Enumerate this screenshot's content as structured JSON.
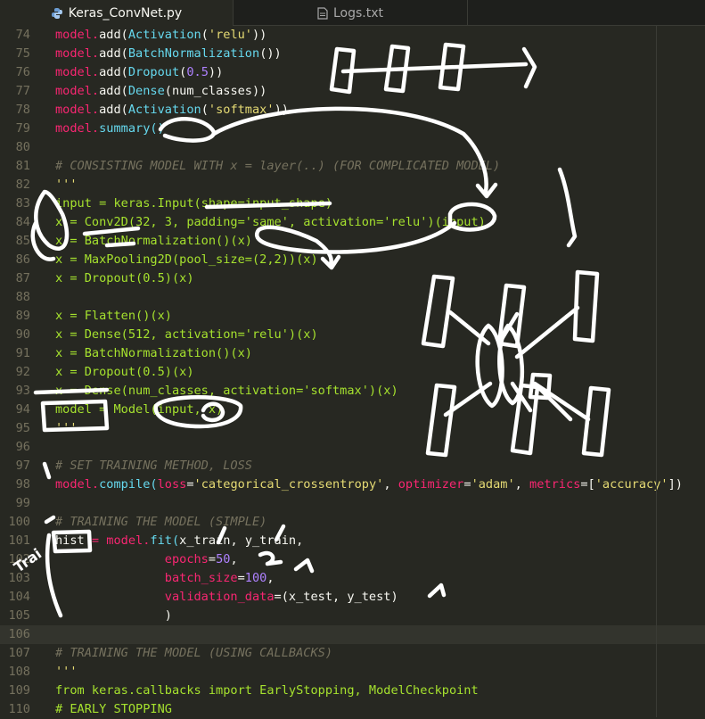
{
  "tabs": [
    {
      "label": "Keras_ConvNet.py",
      "active": true,
      "icon": "python-icon"
    },
    {
      "label": "Logs.txt",
      "active": false,
      "icon": "text-file-icon"
    }
  ],
  "editor": {
    "current_line": "106",
    "lines": [
      {
        "num": "74",
        "segs": [
          {
            "t": "model.",
            "c": "k"
          },
          {
            "t": "add(",
            "c": "w"
          },
          {
            "t": "Activation",
            "c": "f"
          },
          {
            "t": "(",
            "c": "w"
          },
          {
            "t": "'relu'",
            "c": "s"
          },
          {
            "t": "))",
            "c": "w"
          }
        ]
      },
      {
        "num": "75",
        "segs": [
          {
            "t": "model.",
            "c": "k"
          },
          {
            "t": "add(",
            "c": "w"
          },
          {
            "t": "BatchNormalization",
            "c": "f"
          },
          {
            "t": "())",
            "c": "w"
          }
        ]
      },
      {
        "num": "76",
        "segs": [
          {
            "t": "model.",
            "c": "k"
          },
          {
            "t": "add(",
            "c": "w"
          },
          {
            "t": "Dropout",
            "c": "f"
          },
          {
            "t": "(",
            "c": "w"
          },
          {
            "t": "0.5",
            "c": "n"
          },
          {
            "t": "))",
            "c": "w"
          }
        ]
      },
      {
        "num": "77",
        "segs": [
          {
            "t": "model.",
            "c": "k"
          },
          {
            "t": "add(",
            "c": "w"
          },
          {
            "t": "Dense",
            "c": "f"
          },
          {
            "t": "(num_classes))",
            "c": "w"
          }
        ]
      },
      {
        "num": "78",
        "segs": [
          {
            "t": "model.",
            "c": "k"
          },
          {
            "t": "add(",
            "c": "w"
          },
          {
            "t": "Activation",
            "c": "f"
          },
          {
            "t": "(",
            "c": "w"
          },
          {
            "t": "'softmax'",
            "c": "s"
          },
          {
            "t": "))",
            "c": "w"
          }
        ]
      },
      {
        "num": "79",
        "segs": [
          {
            "t": "model.",
            "c": "k"
          },
          {
            "t": "summary()",
            "c": "f"
          }
        ]
      },
      {
        "num": "80",
        "segs": []
      },
      {
        "num": "81",
        "segs": [
          {
            "t": "# CONSISTING MODEL WITH x = layer(..) (FOR COMPLICATED MODEL)",
            "c": "c"
          }
        ]
      },
      {
        "num": "82",
        "segs": [
          {
            "t": "'''",
            "c": "s"
          }
        ]
      },
      {
        "num": "83",
        "segs": [
          {
            "t": "input = keras.Input(shape=input_shape)",
            "c": "g"
          }
        ]
      },
      {
        "num": "84",
        "segs": [
          {
            "t": "x = Conv2D(32, 3, padding='same', activation='relu')(input)",
            "c": "g"
          }
        ]
      },
      {
        "num": "85",
        "segs": [
          {
            "t": "x = BatchNormalization()(x)",
            "c": "g"
          }
        ]
      },
      {
        "num": "86",
        "segs": [
          {
            "t": "x = MaxPooling2D(pool_size=(2,2))(x)",
            "c": "g"
          }
        ]
      },
      {
        "num": "87",
        "segs": [
          {
            "t": "x = Dropout(0.5)(x)",
            "c": "g"
          }
        ]
      },
      {
        "num": "88",
        "segs": []
      },
      {
        "num": "89",
        "segs": [
          {
            "t": "x = Flatten()(x)",
            "c": "g"
          }
        ]
      },
      {
        "num": "90",
        "segs": [
          {
            "t": "x = Dense(512, activation='relu')(x)",
            "c": "g"
          }
        ]
      },
      {
        "num": "91",
        "segs": [
          {
            "t": "x = BatchNormalization()(x)",
            "c": "g"
          }
        ]
      },
      {
        "num": "92",
        "segs": [
          {
            "t": "x = Dropout(0.5)(x)",
            "c": "g"
          }
        ]
      },
      {
        "num": "93",
        "segs": [
          {
            "t": "x = Dense(num_classes, activation='softmax')(x)",
            "c": "g"
          }
        ]
      },
      {
        "num": "94",
        "segs": [
          {
            "t": "model = Model(input, x)",
            "c": "g"
          }
        ]
      },
      {
        "num": "95",
        "segs": [
          {
            "t": "'''",
            "c": "s"
          }
        ]
      },
      {
        "num": "96",
        "segs": []
      },
      {
        "num": "97",
        "segs": [
          {
            "t": "# SET TRAINING METHOD, LOSS",
            "c": "c"
          }
        ]
      },
      {
        "num": "98",
        "segs": [
          {
            "t": "model.",
            "c": "k"
          },
          {
            "t": "compile(",
            "c": "f"
          },
          {
            "t": "loss",
            "c": "k"
          },
          {
            "t": "=",
            "c": "w"
          },
          {
            "t": "'categorical_crossentropy'",
            "c": "s"
          },
          {
            "t": ", ",
            "c": "w"
          },
          {
            "t": "optimizer",
            "c": "k"
          },
          {
            "t": "=",
            "c": "w"
          },
          {
            "t": "'adam'",
            "c": "s"
          },
          {
            "t": ", ",
            "c": "w"
          },
          {
            "t": "metrics",
            "c": "k"
          },
          {
            "t": "=[",
            "c": "w"
          },
          {
            "t": "'accuracy'",
            "c": "s"
          },
          {
            "t": "])",
            "c": "w"
          }
        ]
      },
      {
        "num": "99",
        "segs": []
      },
      {
        "num": "100",
        "segs": [
          {
            "t": "# TRAINING THE MODEL (SIMPLE)",
            "c": "c"
          }
        ]
      },
      {
        "num": "101",
        "segs": [
          {
            "t": "hist ",
            "c": "w"
          },
          {
            "t": "= ",
            "c": "o"
          },
          {
            "t": "model.",
            "c": "k"
          },
          {
            "t": "fit(",
            "c": "f"
          },
          {
            "t": "x_train, y_train,",
            "c": "w"
          }
        ]
      },
      {
        "num": "102",
        "segs": [
          {
            "t": "               ",
            "c": "w"
          },
          {
            "t": "epochs",
            "c": "k"
          },
          {
            "t": "=",
            "c": "w"
          },
          {
            "t": "50",
            "c": "n"
          },
          {
            "t": ",",
            "c": "w"
          }
        ]
      },
      {
        "num": "103",
        "segs": [
          {
            "t": "               ",
            "c": "w"
          },
          {
            "t": "batch_size",
            "c": "k"
          },
          {
            "t": "=",
            "c": "w"
          },
          {
            "t": "100",
            "c": "n"
          },
          {
            "t": ",",
            "c": "w"
          }
        ]
      },
      {
        "num": "104",
        "segs": [
          {
            "t": "               ",
            "c": "w"
          },
          {
            "t": "validation_data",
            "c": "k"
          },
          {
            "t": "=(x_test, y_test)",
            "c": "w"
          }
        ]
      },
      {
        "num": "105",
        "segs": [
          {
            "t": "               )",
            "c": "w"
          }
        ]
      },
      {
        "num": "106",
        "segs": []
      },
      {
        "num": "107",
        "segs": [
          {
            "t": "# TRAINING THE MODEL (USING CALLBACKS)",
            "c": "c"
          }
        ]
      },
      {
        "num": "108",
        "segs": [
          {
            "t": "'''",
            "c": "s"
          }
        ]
      },
      {
        "num": "109",
        "segs": [
          {
            "t": "from keras.callbacks import EarlyStopping, ModelCheckpoint",
            "c": "g"
          }
        ]
      },
      {
        "num": "110",
        "segs": [
          {
            "t": "# EARLY STOPPING",
            "c": "g"
          }
        ]
      }
    ]
  },
  "handwriting": {
    "text": "Trai"
  },
  "colors": {
    "background": "#272822",
    "keyword": "#f92672",
    "function": "#66d9ef",
    "string": "#e6db74",
    "number": "#ae81ff",
    "comment": "#75715e",
    "docstring": "#a6e22e",
    "ink": "#ffffff"
  }
}
